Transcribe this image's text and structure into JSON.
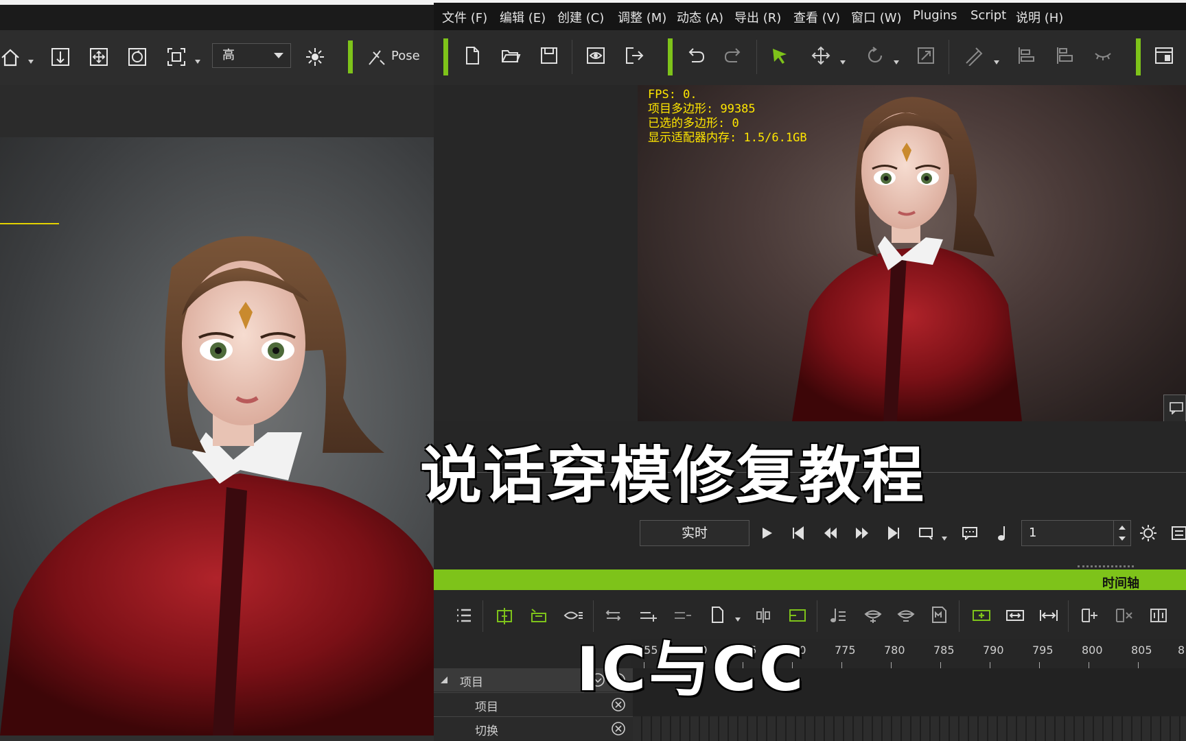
{
  "menu": [
    "文件 (F)",
    "编辑 (E)",
    "创建 (C)",
    "调整 (M)",
    "动态 (A)",
    "导出 (R)",
    "查看 (V)",
    "窗口 (W)",
    "Plugins",
    "Script",
    "说明 (H)"
  ],
  "left_toolbar": {
    "quality_value": "高",
    "pose_label": "Pose"
  },
  "viewport_stats": {
    "fps": "FPS: 0.",
    "polygons": "项目多边形: 99385",
    "selected": "已选的多边形: 0",
    "memory": "显示适配器内存: 1.5/6.1GB"
  },
  "playback": {
    "mode": "实时",
    "frame": "1"
  },
  "timeline": {
    "title": "时间轴",
    "ticks": [
      "755",
      "760",
      "765",
      "770",
      "775",
      "780",
      "785",
      "790",
      "795",
      "800",
      "805",
      "8"
    ],
    "tracks": [
      "项目",
      "项目",
      "切换"
    ]
  },
  "overlay": {
    "title": "说话穿模修复教程",
    "subtitle": "IC与CC"
  },
  "colors": {
    "accent_green": "#7ec31a",
    "stats_yellow": "#ffe600",
    "menubar": "#151515"
  }
}
